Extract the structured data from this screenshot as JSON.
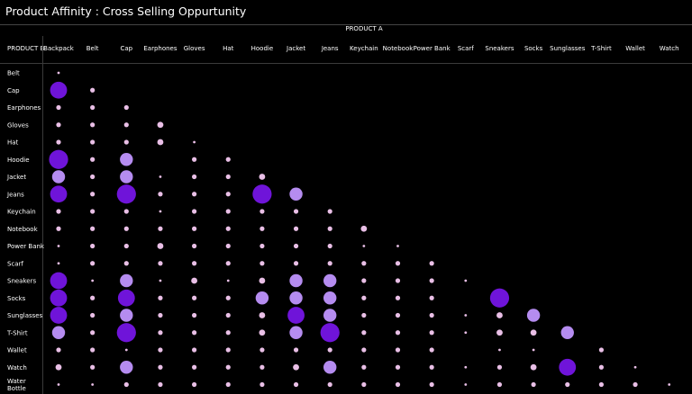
{
  "header": {
    "title": "Product Affinity : Cross Selling Oppurtunity"
  },
  "colors": {
    "background": "#000000",
    "low": "#e9bfe6",
    "mid": "#b58cf0",
    "high": "#6f14d9",
    "divider": "#3a3a3a"
  },
  "chart_data": {
    "type": "scatter",
    "x_header": "PRODUCT A",
    "y_header": "PRODUCT B",
    "x_categories": [
      "Backpack",
      "Belt",
      "Cap",
      "Earphones",
      "Gloves",
      "Hat",
      "Hoodie",
      "Jacket",
      "Jeans",
      "Keychain",
      "Notebook",
      "Power Bank",
      "Scarf",
      "Sneakers",
      "Socks",
      "Sunglasses",
      "T-Shirt",
      "Wallet",
      "Watch"
    ],
    "y_categories": [
      "Belt",
      "Cap",
      "Earphones",
      "Gloves",
      "Hat",
      "Hoodie",
      "Jacket",
      "Jeans",
      "Keychain",
      "Notebook",
      "Power Bank",
      "Scarf",
      "Sneakers",
      "Socks",
      "Sunglasses",
      "T-Shirt",
      "Wallet",
      "Watch",
      "Water Bottle"
    ],
    "values": [
      [
        1
      ],
      [
        5,
        2
      ],
      [
        2,
        2,
        2
      ],
      [
        2,
        2,
        2,
        3
      ],
      [
        2,
        2,
        2,
        3,
        1
      ],
      [
        6,
        2,
        4,
        0,
        2,
        2
      ],
      [
        4,
        2,
        4,
        1,
        2,
        2,
        3
      ],
      [
        5,
        2,
        6,
        2,
        2,
        2,
        6,
        4
      ],
      [
        2,
        2,
        2,
        1,
        2,
        2,
        2,
        2,
        2
      ],
      [
        2,
        2,
        2,
        2,
        2,
        2,
        2,
        2,
        2,
        3
      ],
      [
        1,
        2,
        2,
        3,
        2,
        2,
        2,
        2,
        2,
        1,
        1
      ],
      [
        1,
        2,
        2,
        2,
        2,
        2,
        2,
        2,
        2,
        2,
        2,
        2
      ],
      [
        5,
        1,
        4,
        1,
        3,
        1,
        3,
        4,
        4,
        2,
        2,
        2,
        1
      ],
      [
        5,
        2,
        5,
        2,
        2,
        2,
        4,
        4,
        4,
        2,
        2,
        2,
        0,
        6
      ],
      [
        5,
        2,
        4,
        2,
        2,
        2,
        3,
        5,
        4,
        2,
        2,
        2,
        1,
        3,
        4
      ],
      [
        4,
        2,
        6,
        2,
        2,
        2,
        3,
        4,
        6,
        2,
        2,
        2,
        1,
        3,
        3,
        4
      ],
      [
        2,
        2,
        1,
        2,
        2,
        2,
        2,
        2,
        2,
        2,
        2,
        2,
        0,
        1,
        1,
        0,
        2
      ],
      [
        3,
        2,
        4,
        2,
        2,
        2,
        2,
        3,
        4,
        2,
        2,
        2,
        1,
        2,
        3,
        5,
        2,
        1
      ],
      [
        1,
        1,
        2,
        2,
        2,
        2,
        2,
        2,
        2,
        2,
        2,
        2,
        1,
        2,
        2,
        2,
        2,
        2,
        1
      ]
    ],
    "value_scale": "relative co-purchase count (0 none, 6 highest); encoded by circle size and colour"
  }
}
